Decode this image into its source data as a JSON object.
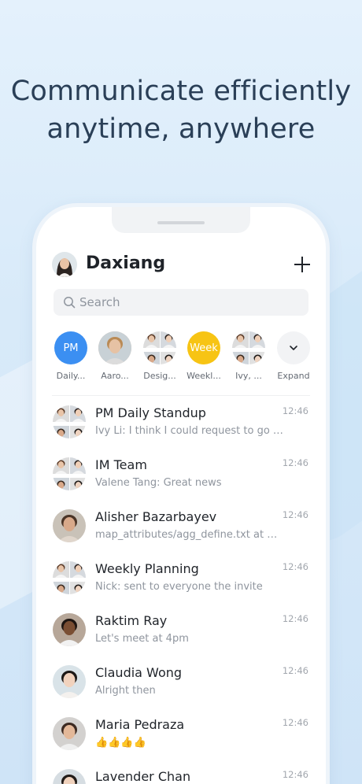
{
  "headline": {
    "line1": "Communicate efficiently",
    "line2": "anytime, anywhere"
  },
  "app": {
    "title": "Daxiang",
    "new_icon": "plus-icon",
    "search_placeholder": "Search",
    "search_icon": "search-icon"
  },
  "quick_access": [
    {
      "label": "Daily...",
      "badge": "PM",
      "color": "#3b8ff2",
      "type": "text"
    },
    {
      "label": "Aaro...",
      "badge": "",
      "color": "#c9a58a",
      "type": "person"
    },
    {
      "label": "Desig...",
      "badge": "",
      "color": "#b9b9b9",
      "type": "group"
    },
    {
      "label": "Weekl...",
      "badge": "Week",
      "color": "#f7c414",
      "type": "text"
    },
    {
      "label": "Ivy, ...",
      "badge": "",
      "color": "#b9b9b9",
      "type": "group"
    },
    {
      "label": "Expand",
      "badge": "",
      "color": "#f2f3f5",
      "type": "expand",
      "icon": "chevron-down-icon"
    }
  ],
  "chats": [
    {
      "name": "PM Daily Standup",
      "message": "Ivy Li: I think I could request to go if...",
      "time": "12:46",
      "avatar": "group"
    },
    {
      "name": "IM Team",
      "message": "Valene Tang: Great news",
      "time": "12:46",
      "avatar": "group"
    },
    {
      "name": "Alisher Bazarbayev",
      "message": "map_attributes/agg_define.txt at m...",
      "time": "12:46",
      "avatar": "person"
    },
    {
      "name": "Weekly Planning",
      "message": "Nick: sent to everyone the invite",
      "time": "12:46",
      "avatar": "group"
    },
    {
      "name": "Raktim Ray",
      "message": "Let's meet at 4pm",
      "time": "12:46",
      "avatar": "person"
    },
    {
      "name": "Claudia Wong",
      "message": "Alright then",
      "time": "12:46",
      "avatar": "person"
    },
    {
      "name": "Maria Pedraza",
      "message": "👍👍👍👍",
      "time": "12:46",
      "avatar": "person"
    },
    {
      "name": "Lavender Chan",
      "message": "",
      "time": "12:46",
      "avatar": "person"
    }
  ],
  "colors": {
    "accent_blue": "#3b8ff2",
    "accent_yellow": "#f7c414",
    "headline": "#2a3f57"
  }
}
